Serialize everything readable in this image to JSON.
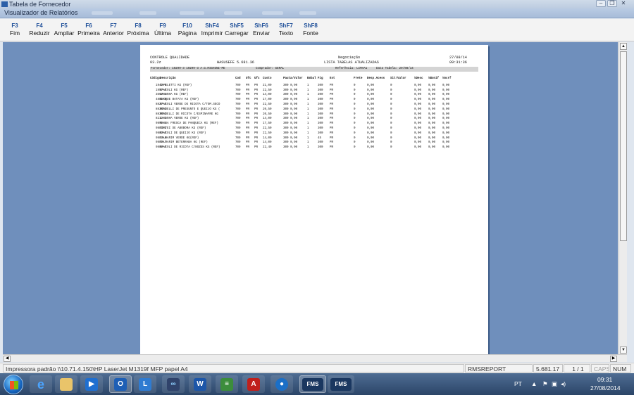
{
  "window": {
    "outer_title": "Tabela de Fornecedor",
    "inner_title": "Visualizador de Relatórios",
    "controls": [
      "minimize",
      "restore",
      "close"
    ]
  },
  "toolbar": {
    "buttons": [
      {
        "key": "F3",
        "label": "Fim"
      },
      {
        "key": "F4",
        "label": "Reduzir"
      },
      {
        "key": "F5",
        "label": "Ampliar"
      },
      {
        "key": "F6",
        "label": "Primeira"
      },
      {
        "key": "F7",
        "label": "Anterior"
      },
      {
        "key": "F8",
        "label": "Próxima"
      },
      {
        "key": "F9",
        "label": "Última"
      },
      {
        "key": "F10",
        "label": "Página"
      },
      {
        "key": "ShF4",
        "label": "Imprimir"
      },
      {
        "key": "ShF5",
        "label": "Carregar"
      },
      {
        "key": "ShF6",
        "label": "Enviar"
      },
      {
        "key": "ShF7",
        "label": "Texto"
      },
      {
        "key": "ShF8",
        "label": "Fonte"
      }
    ]
  },
  "report": {
    "title_left": "CONTROLE QUALIDADE",
    "code_left": "03.2z",
    "title_center": "WASUSEFE 5.681.36",
    "title_right_1": "Negociação",
    "title_right_2": "LISTA TABELAS ATUALIZADAS",
    "date": "27/08/14",
    "time": "09:31:36",
    "bar": {
      "fornecedor": "Fornecedor: 19299-3 19299-3 A.G.RIGHINI-ME",
      "comprador": "Comprador: GERAL",
      "referencia": "Referência: LIMAA1",
      "data_tabela": "Data Tabela: 29/08/14"
    },
    "columns": [
      "Código",
      "Descrição",
      "Cod",
      "Ufc",
      "Ufc",
      "Custo",
      "Pauta/Valor",
      "Embal",
      "Fig",
      "Est",
      "Frete",
      "Desp.Acess",
      "Sit/Valor",
      "%Desc",
      "%Bonif",
      "%Acrf"
    ],
    "rows": [
      {
        "codigo": "1945-5",
        "descricao": "CAPELETTI KG (REF)",
        "cod": "709",
        "u1": "PR",
        "u2": "PR",
        "custo": "21,00",
        "pauta": "300 0,00",
        "embal": "1",
        "fig": "300",
        "est": "PR",
        "frete": "0",
        "desp": "0,00",
        "sit": "0",
        "desc": "0,00",
        "bonif": "0,00",
        "acrf": "0,00"
      },
      {
        "codigo": "1957-0",
        "descricao": "RAVIOLI KG (REF)",
        "cod": "709",
        "u1": "PR",
        "u2": "PR",
        "custo": "22,50",
        "pauta": "300 0,00",
        "embal": "1",
        "fig": "300",
        "est": "PR",
        "frete": "0",
        "desp": "0,00",
        "sit": "0",
        "desc": "0,00",
        "bonif": "0,00",
        "acrf": "0,00"
      },
      {
        "codigo": "3560-4",
        "descricao": "LASANHA KG (REF)",
        "cod": "709",
        "u1": "PR",
        "u2": "PR",
        "custo": "14,00",
        "pauta": "300 0,00",
        "embal": "1",
        "fig": "300",
        "est": "PR",
        "frete": "0",
        "desp": "0,00",
        "sit": "0",
        "desc": "0,00",
        "bonif": "0,00",
        "acrf": "0,00"
      },
      {
        "codigo": "4881-8",
        "descricao": "NHOQUE BATATA KG (REF)",
        "cod": "709",
        "u1": "PR",
        "u2": "PR",
        "custo": "17,00",
        "pauta": "300 0,00",
        "embal": "1",
        "fig": "300",
        "est": "PR",
        "frete": "0",
        "desp": "0,00",
        "sit": "0",
        "desc": "0,00",
        "bonif": "0,00",
        "acrf": "0,00"
      },
      {
        "codigo": "8827-5",
        "descricao": "RAVIOLI VERDE DE RICOTA C/TOM.SECO",
        "cod": "709",
        "u1": "PR",
        "u2": "PR",
        "custo": "22,50",
        "pauta": "300 0,00",
        "embal": "1",
        "fig": "300",
        "est": "PR",
        "frete": "0",
        "desp": "0,00",
        "sit": "0",
        "desc": "0,00",
        "bonif": "0,00",
        "acrf": "0,00"
      },
      {
        "codigo": "8838-1",
        "descricao": "RONDELLI DE PRESUNTO E QUEIJO KG (",
        "cod": "709",
        "u1": "PR",
        "u2": "PR",
        "custo": "20,50",
        "pauta": "300 0,00",
        "embal": "1",
        "fig": "300",
        "est": "PR",
        "frete": "0",
        "desp": "0,00",
        "sit": "0",
        "desc": "0,00",
        "bonif": "0,00",
        "acrf": "0,00"
      },
      {
        "codigo": "8839-1",
        "descricao": "RONDELLI DE RICOTA C/ESPINAFRE KG",
        "cod": "709",
        "u1": "PR",
        "u2": "PR",
        "custo": "20,50",
        "pauta": "300 0,00",
        "embal": "1",
        "fig": "300",
        "est": "PR",
        "frete": "0",
        "desp": "0,00",
        "sit": "0",
        "desc": "0,00",
        "bonif": "0,00",
        "acrf": "0,00"
      },
      {
        "codigo": "8211-3",
        "descricao": "LASANHA VERDE KG (REF)",
        "cod": "709",
        "u1": "PR",
        "u2": "PR",
        "custo": "14,00",
        "pauta": "300 0,00",
        "embal": "1",
        "fig": "300",
        "est": "PR",
        "frete": "0",
        "desp": "0,00",
        "sit": "0",
        "desc": "0,00",
        "bonif": "0,00",
        "acrf": "0,00"
      },
      {
        "codigo": "9891-4",
        "descricao": "MASSA FRESCA DE PANQUECA KG (REF)",
        "cod": "709",
        "u1": "PR",
        "u2": "PR",
        "custo": "17,50",
        "pauta": "300 0,00",
        "embal": "1",
        "fig": "300",
        "est": "PR",
        "frete": "0",
        "desp": "0,00",
        "sit": "0",
        "desc": "0,00",
        "bonif": "0,00",
        "acrf": "0,00"
      },
      {
        "codigo": "9883-2",
        "descricao": "TORTEI DE ABOBORA KG (REF)",
        "cod": "709",
        "u1": "PR",
        "u2": "PR",
        "custo": "22,50",
        "pauta": "300 0,00",
        "embal": "1",
        "fig": "300",
        "est": "PR",
        "frete": "0",
        "desp": "0,00",
        "sit": "0",
        "desc": "0,00",
        "bonif": "0,00",
        "acrf": "0,00"
      },
      {
        "codigo": "9883-0",
        "descricao": "RAVIOLI DE QUEIJO KG (REF)",
        "cod": "709",
        "u1": "PR",
        "u2": "PR",
        "custo": "22,50",
        "pauta": "300 0,00",
        "embal": "1",
        "fig": "300",
        "est": "PR",
        "frete": "0",
        "desp": "0,00",
        "sit": "0",
        "desc": "0,00",
        "bonif": "0,00",
        "acrf": "0,00"
      },
      {
        "codigo": "9884-8",
        "descricao": "TALHARIM VERDE KG(REF)",
        "cod": "709",
        "u1": "PR",
        "u2": "PR",
        "custo": "14,00",
        "pauta": "300 0,00",
        "embal": "1",
        "fig": "45",
        "est": "PR",
        "frete": "0",
        "desp": "0,00",
        "sit": "0",
        "desc": "0,00",
        "bonif": "0,00",
        "acrf": "0,00"
      },
      {
        "codigo": "9885-7",
        "descricao": "TALHARIM BETERRABA KG (REF)",
        "cod": "709",
        "u1": "PR",
        "u2": "PR",
        "custo": "14,00",
        "pauta": "300 0,00",
        "embal": "1",
        "fig": "300",
        "est": "PR",
        "frete": "0",
        "desp": "0,00",
        "sit": "0",
        "desc": "0,00",
        "bonif": "0,00",
        "acrf": "0,00"
      },
      {
        "codigo": "9888-5",
        "descricao": "RAVIOLI DE RICOTA C/NOZES KG (REF)",
        "cod": "709",
        "u1": "PR",
        "u2": "PR",
        "custo": "22,40",
        "pauta": "300 0,00",
        "embal": "1",
        "fig": "300",
        "est": "PR",
        "frete": "0",
        "desp": "0,00",
        "sit": "0",
        "desc": "0,00",
        "bonif": "0,00",
        "acrf": "0,00"
      }
    ]
  },
  "statusbar": {
    "printer": "Impressora padrão \\\\10.71.4.150\\HP LaserJet M1319f MFP papel A4",
    "report_name": "RMSREPORT",
    "version": "5.681.17",
    "page": "1 / 1",
    "caps": "CAPS",
    "num": "NUM"
  },
  "taskbar": {
    "apps": [
      "windows-explorer",
      "internet-explorer",
      "file-explorer",
      "outlook-calendar",
      "outlook",
      "lync",
      "remote-desktop",
      "word",
      "stack-app",
      "acrobat",
      "chrome",
      "rms-1",
      "rms-2"
    ],
    "fms_label": "FMS",
    "language": "PT",
    "time": "09:31",
    "date": "27/08/2014"
  }
}
